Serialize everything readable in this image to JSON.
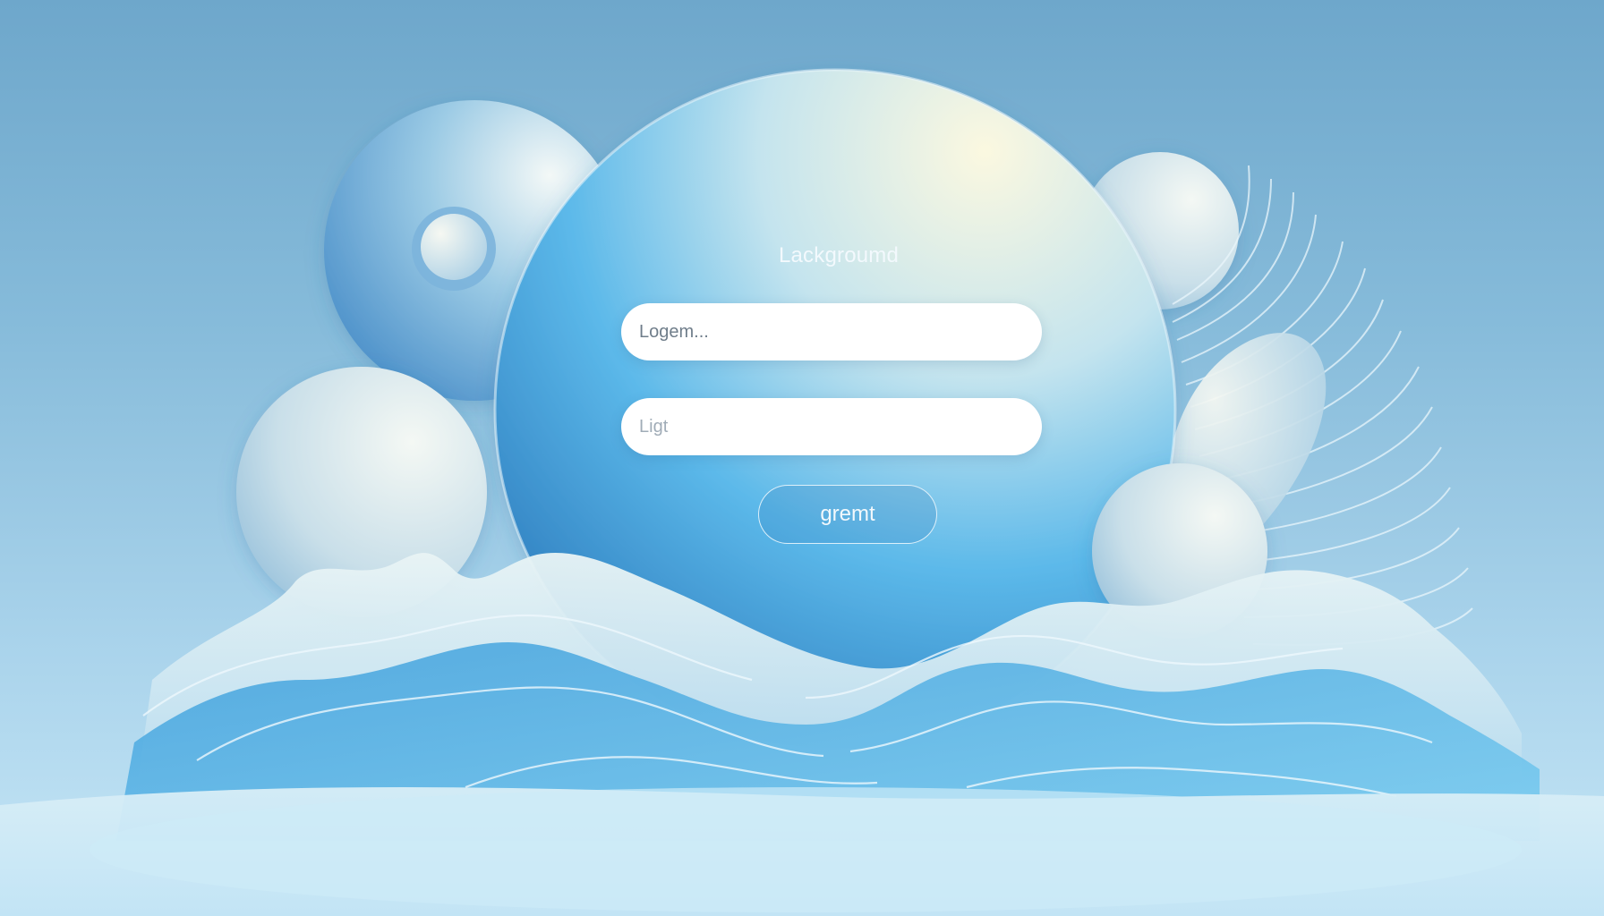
{
  "login": {
    "title": "Lackgroumd",
    "username_placeholder": "Logem...",
    "password_placeholder": "Ligt",
    "submit_label": "gremt"
  },
  "colors": {
    "background_top": "#6ea7cb",
    "background_bottom": "#c6e6f6",
    "accent_blue": "#3a8fd0",
    "field_background": "#ffffff"
  }
}
